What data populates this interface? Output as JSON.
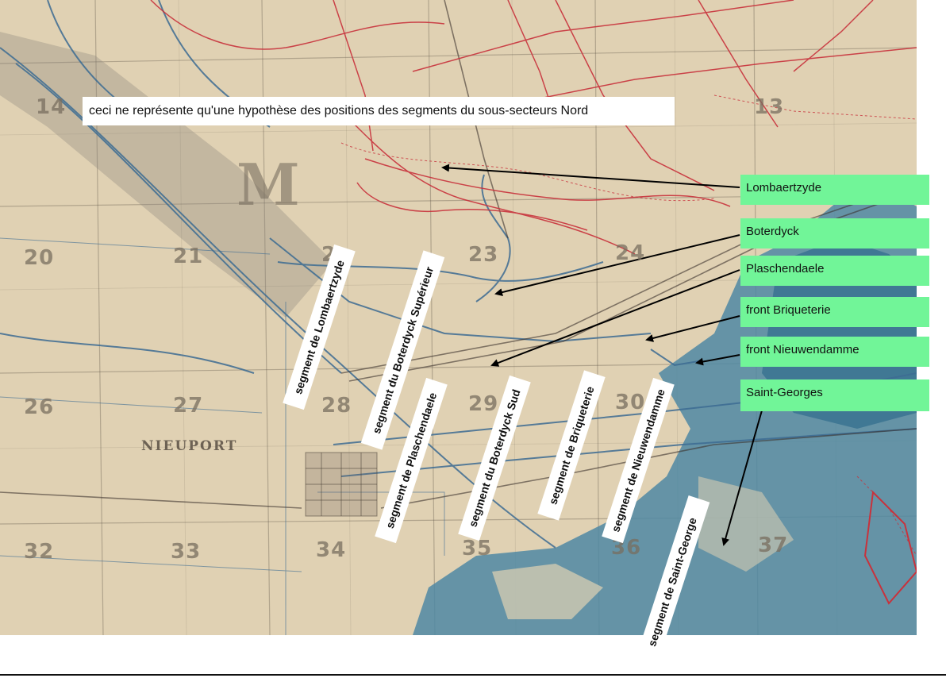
{
  "caption": "ceci ne représente qu'une hypothèse des positions des segments du sous-secteurs Nord",
  "front_labels": [
    {
      "id": "lombaertzyde",
      "text": "Lombaertzyde"
    },
    {
      "id": "boterdyck",
      "text": "Boterdyck"
    },
    {
      "id": "plaschendaele",
      "text": "Plaschendaele"
    },
    {
      "id": "front-briqueterie",
      "text": "front Briqueterie"
    },
    {
      "id": "front-nieuwendamme",
      "text": "front Nieuwendamme"
    },
    {
      "id": "saint-georges",
      "text": "Saint-Georges"
    }
  ],
  "segment_labels": [
    {
      "id": "lombaertzyde",
      "text": "segment de Lombaertzyde"
    },
    {
      "id": "boterdyck-superieur",
      "text": "segment du Boterdyck Supérieur"
    },
    {
      "id": "plaschendaele",
      "text": "segment de Plaschendaele"
    },
    {
      "id": "boterdyck-sud",
      "text": "segment du Boterdyck Sud"
    },
    {
      "id": "briqueterie",
      "text": "segment de Briqueterie"
    },
    {
      "id": "nieuwendamme",
      "text": "segment de Nieuwendamme"
    },
    {
      "id": "saint-george",
      "text": "segment de Saint-George"
    }
  ],
  "map": {
    "grid_numbers": [
      "14",
      "13",
      "20",
      "21",
      "2",
      "23",
      "24",
      "26",
      "27",
      "28",
      "29",
      "30",
      "32",
      "33",
      "34",
      "35",
      "36",
      "37"
    ],
    "sheet_letter": "M",
    "town_name": "NIEUPORT",
    "colors": {
      "paper": "#e0d1b3",
      "trenches": "#c8323c",
      "water": "#4f88a3",
      "canals": "#3d6c93",
      "label_bg": "#71f598"
    }
  }
}
